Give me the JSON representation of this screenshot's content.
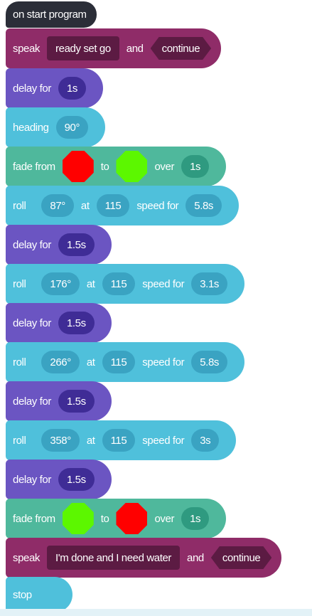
{
  "program": {
    "start_label": "on start program",
    "colors": {
      "red": "#ff0000",
      "green": "#5cf700",
      "speak": "#8f2c68",
      "delay": "#6b55c2",
      "motion": "#4fc0db",
      "light": "#4fb89c",
      "start": "#2b2e38"
    },
    "blocks": [
      {
        "type": "speak",
        "label": "speak",
        "text": "ready set go",
        "and": "and",
        "mode": "continue"
      },
      {
        "type": "delay",
        "label": "delay for",
        "duration": "1s"
      },
      {
        "type": "heading",
        "label": "heading",
        "angle": "90°"
      },
      {
        "type": "fade",
        "label": "fade from",
        "from_color": "red",
        "to": "to",
        "to_color": "green",
        "over": "over",
        "duration": "1s"
      },
      {
        "type": "roll",
        "label": "roll",
        "angle": "87°",
        "at": "at",
        "speed": "115",
        "speed_for": "speed for",
        "duration": "5.8s"
      },
      {
        "type": "delay",
        "label": "delay for",
        "duration": "1.5s"
      },
      {
        "type": "roll",
        "label": "roll",
        "angle": "176°",
        "at": "at",
        "speed": "115",
        "speed_for": "speed for",
        "duration": "3.1s"
      },
      {
        "type": "delay",
        "label": "delay for",
        "duration": "1.5s"
      },
      {
        "type": "roll",
        "label": "roll",
        "angle": "266°",
        "at": "at",
        "speed": "115",
        "speed_for": "speed for",
        "duration": "5.8s"
      },
      {
        "type": "delay",
        "label": "delay for",
        "duration": "1.5s"
      },
      {
        "type": "roll",
        "label": "roll",
        "angle": "358°",
        "at": "at",
        "speed": "115",
        "speed_for": "speed for",
        "duration": "3s"
      },
      {
        "type": "delay",
        "label": "delay for",
        "duration": "1.5s"
      },
      {
        "type": "fade",
        "label": "fade from",
        "from_color": "green",
        "to": "to",
        "to_color": "red",
        "over": "over",
        "duration": "1s"
      },
      {
        "type": "speak",
        "label": "speak",
        "text": "I'm done and I need water",
        "and": "and",
        "mode": "continue"
      },
      {
        "type": "stop",
        "label": "stop"
      }
    ]
  }
}
